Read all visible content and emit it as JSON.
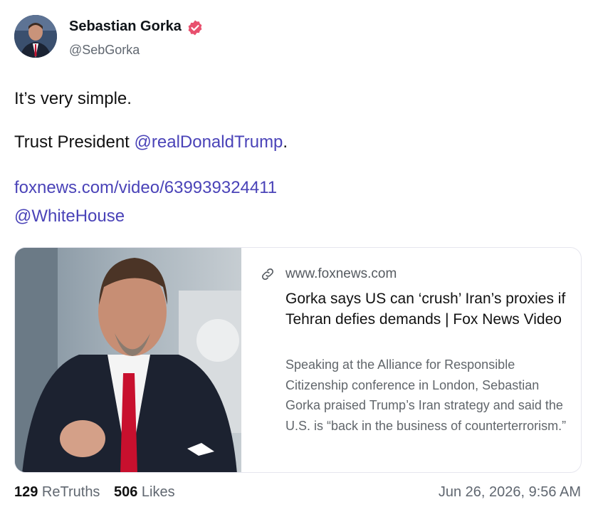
{
  "author": {
    "name": "Sebastian Gorka",
    "handle": "@SebGorka"
  },
  "post": {
    "line1": "It’s very simple.",
    "line2_prefix": "Trust President ",
    "line2_mention": "@realDonaldTrump",
    "line2_suffix": ".",
    "link_url": "foxnews.com/video/639939324411",
    "mention2": "@WhiteHouse"
  },
  "card": {
    "domain": "www.foxnews.com",
    "title": "Gorka says US can ‘crush’ Iran’s proxies if Tehran defies demands | Fox News Video",
    "description": "Speaking at the Alliance for Responsible Citizenship conference in London, Sebastian Gorka praised Trump’s Iran strategy and said the U.S. is “back in the business of counterterrorism.”"
  },
  "stats": {
    "retruths_count": "129",
    "retruths_label": " ReTruths",
    "likes_count": "506",
    "likes_label": " Likes"
  },
  "timestamp": "Jun 26, 2026, 9:56 AM",
  "colors": {
    "link": "#4a43b8",
    "verified": "#e8506e",
    "muted": "#606770"
  },
  "icons": {
    "verified": "verified-badge-icon",
    "link": "link-chain-icon"
  }
}
